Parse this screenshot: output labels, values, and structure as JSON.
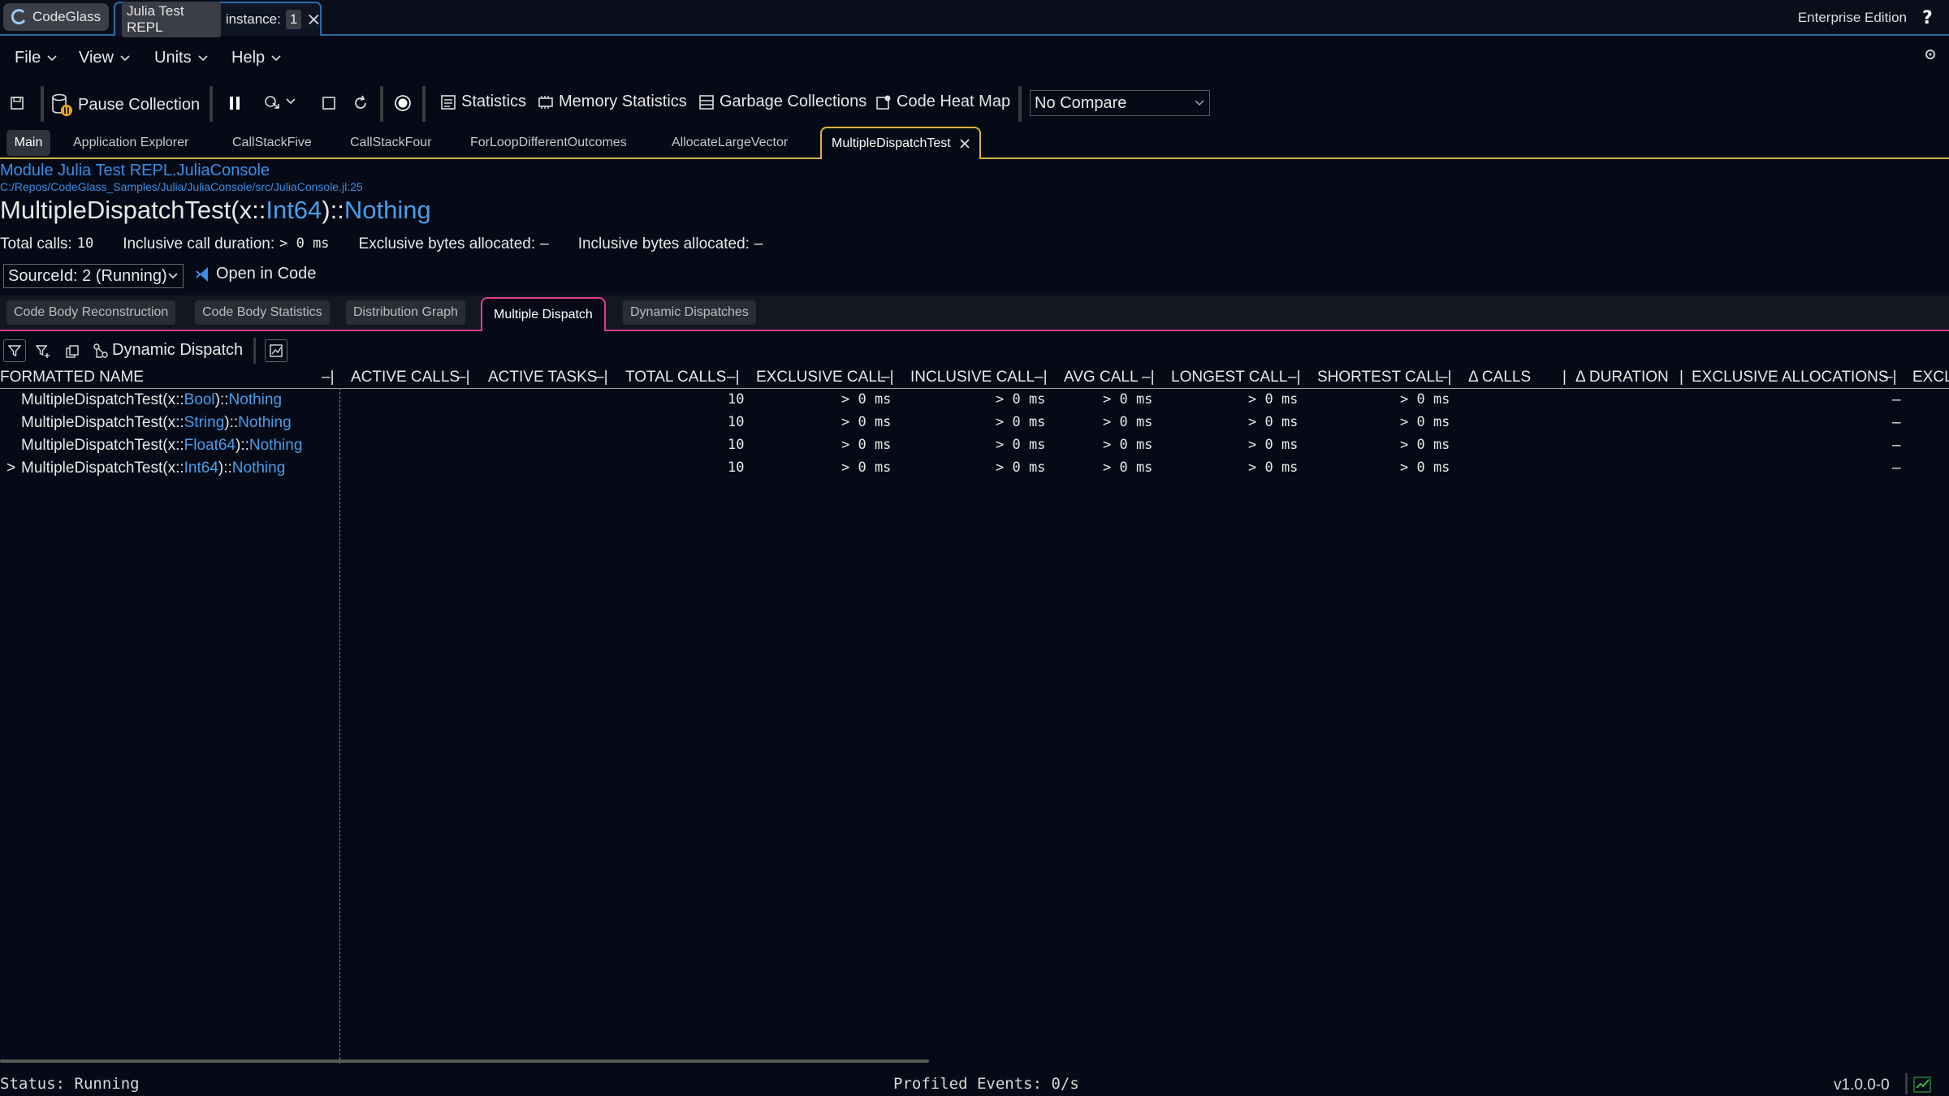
{
  "titlebar": {
    "app_tab": "CodeGlass",
    "repl_tab": "Julia Test REPL",
    "instance_label": "instance:",
    "instance_value": "1",
    "edition": "Enterprise Edition"
  },
  "menu": {
    "items": [
      "File",
      "View",
      "Units",
      "Help"
    ]
  },
  "toolbar": {
    "pause_collection": "Pause Collection",
    "statistics": "Statistics",
    "memory_statistics": "Memory Statistics",
    "garbage_collections": "Garbage Collections",
    "code_heat_map": "Code Heat Map",
    "compare": "No Compare"
  },
  "doc_tabs": [
    "Main",
    "Application Explorer",
    "CallStackFive",
    "CallStackFour",
    "ForLoopDifferentOutcomes",
    "AllocateLargeVector",
    "MultipleDispatchTest"
  ],
  "header": {
    "module": "Module Julia Test REPL.JuliaConsole",
    "path": "C:/Repos/CodeGlass_Samples/Julia/JuliaConsole/src/JuliaConsole.jl:25",
    "fn_name": "MultipleDispatchTest(x::",
    "fn_type": "Int64",
    "fn_mid": ")::",
    "fn_return": "Nothing",
    "total_calls_label": "Total calls:",
    "total_calls_value": "10",
    "inclusive_duration_label": "Inclusive call duration:",
    "inclusive_duration_value": "> 0 ms",
    "exclusive_bytes_label": "Exclusive bytes allocated:",
    "exclusive_bytes_value": "–",
    "inclusive_bytes_label": "Inclusive bytes allocated:",
    "inclusive_bytes_value": "–",
    "source_id": "SourceId: 2 (Running)",
    "open_in_code": "Open in Code"
  },
  "sub_tabs": [
    "Code Body Reconstruction",
    "Code Body Statistics",
    "Distribution Graph",
    "Multiple Dispatch",
    "Dynamic Dispatches"
  ],
  "grid_toolbar": {
    "dynamic_dispatch": "Dynamic Dispatch"
  },
  "table": {
    "columns": [
      "FORMATTED NAME",
      "ACTIVE CALLS",
      "ACTIVE TASKS",
      "TOTAL CALLS",
      "EXCLUSIVE CALL",
      "INCLUSIVE CALL",
      "AVG CALL",
      "LONGEST CALL",
      "SHORTEST CALL",
      "Δ CALLS",
      "Δ DURATION",
      "EXCLUSIVE ALLOCATIONS",
      "EXCL"
    ],
    "rows": [
      {
        "expander": "",
        "name_pre": "MultipleDispatchTest(x::",
        "type": "Bool",
        "name_mid": ")::",
        "ret": "Nothing",
        "total": "10",
        "exclusive": "> 0 ms",
        "inclusive": "> 0 ms",
        "avg": "> 0 ms",
        "longest": "> 0 ms",
        "shortest": "> 0 ms",
        "excl_alloc": "–"
      },
      {
        "expander": "",
        "name_pre": "MultipleDispatchTest(x::",
        "type": "String",
        "name_mid": ")::",
        "ret": "Nothing",
        "total": "10",
        "exclusive": "> 0 ms",
        "inclusive": "> 0 ms",
        "avg": "> 0 ms",
        "longest": "> 0 ms",
        "shortest": "> 0 ms",
        "excl_alloc": "–"
      },
      {
        "expander": "",
        "name_pre": "MultipleDispatchTest(x::",
        "type": "Float64",
        "name_mid": ")::",
        "ret": "Nothing",
        "total": "10",
        "exclusive": "> 0 ms",
        "inclusive": "> 0 ms",
        "avg": "> 0 ms",
        "longest": "> 0 ms",
        "shortest": "> 0 ms",
        "excl_alloc": "–"
      },
      {
        "expander": ">",
        "name_pre": "MultipleDispatchTest(x::",
        "type": "Int64",
        "name_mid": ")::",
        "ret": "Nothing",
        "total": "10",
        "exclusive": "> 0 ms",
        "inclusive": "> 0 ms",
        "avg": "> 0 ms",
        "longest": "> 0 ms",
        "shortest": "> 0 ms",
        "excl_alloc": "–"
      }
    ]
  },
  "status": {
    "left": "Status: Running",
    "center": "Profiled Events: 0/s",
    "version": "v1.0.0-0"
  },
  "colors": {
    "accent_blue": "#2a6ea8",
    "type_blue": "#4a9ee8",
    "tab_gold": "#d8b24a",
    "tab_pink": "#e03c8a",
    "background": "#060a16"
  }
}
